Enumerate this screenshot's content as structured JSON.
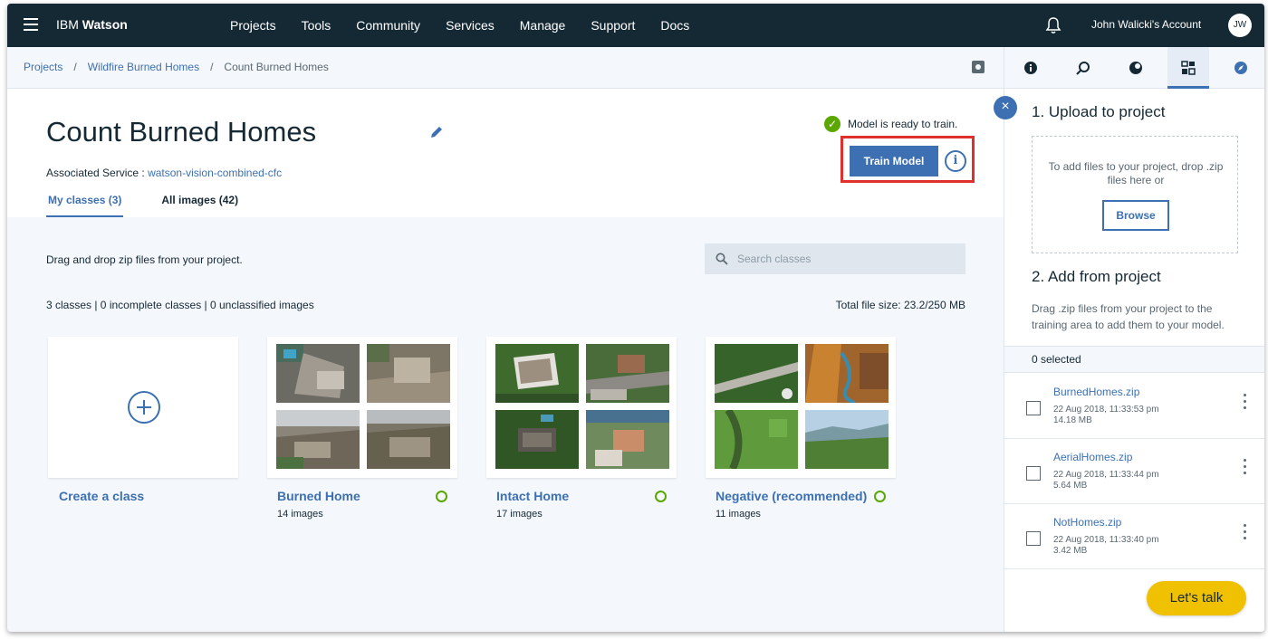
{
  "nav": {
    "brand_prefix": "IBM",
    "brand_name": "Watson",
    "links": [
      "Projects",
      "Tools",
      "Community",
      "Services",
      "Manage",
      "Support",
      "Docs"
    ],
    "account": "John Walicki's Account",
    "avatar_initials": "JW"
  },
  "breadcrumb": {
    "items": [
      "Projects",
      "Wildfire Burned Homes"
    ],
    "separator": "/",
    "current": "Count Burned Homes"
  },
  "header": {
    "title": "Count Burned Homes",
    "assoc_label": "Associated Service : ",
    "assoc_service": "watson-vision-combined-cfc",
    "status": "Model is ready to train.",
    "train_button": "Train Model",
    "info_glyph": "i",
    "tabs": [
      "My classes (3)",
      "All images (42)"
    ]
  },
  "main": {
    "drag_text": "Drag and drop zip files from your project.",
    "search_placeholder": "Search classes",
    "stats": "3 classes | 0 incomplete classes | 0 unclassified images",
    "total_size": "Total file size: 23.2/250 MB",
    "create_label": "Create a class",
    "classes": [
      {
        "name": "Burned Home",
        "count": "14 images"
      },
      {
        "name": "Intact Home",
        "count": "17 images"
      },
      {
        "name": "Negative (recommended)",
        "count": "11 images"
      }
    ]
  },
  "panel": {
    "close_glyph": "×",
    "upload_title": "1. Upload to project",
    "drop_text": "To add files to your project, drop .zip files here or",
    "browse_label": "Browse",
    "add_title": "2. Add from project",
    "add_desc": "Drag .zip files from your project to the training area to add them to your model.",
    "selected": "0 selected",
    "files": [
      {
        "name": "BurnedHomes.zip",
        "date": "22 Aug 2018, 11:33:53 pm",
        "size": "14.18 MB"
      },
      {
        "name": "AerialHomes.zip",
        "date": "22 Aug 2018, 11:33:44 pm",
        "size": "5.64 MB"
      },
      {
        "name": "NotHomes.zip",
        "date": "22 Aug 2018, 11:33:40 pm",
        "size": "3.42 MB"
      }
    ]
  },
  "chat_button": "Let's talk",
  "colors": {
    "accent": "#3d70b2",
    "nav_bg": "#152935",
    "success": "#5aa700",
    "highlight": "#e0302e",
    "chat": "#efc100"
  }
}
